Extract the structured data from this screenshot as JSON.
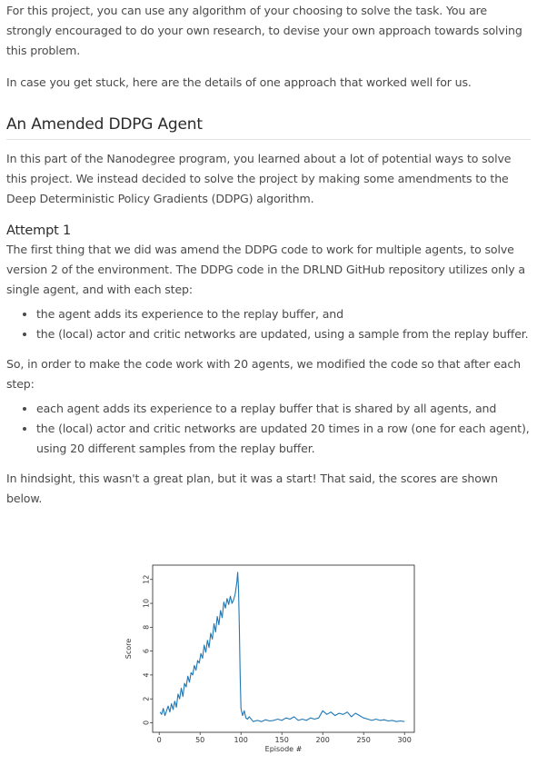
{
  "intro": {
    "p1": "For this project, you can use any algorithm of your choosing to solve the task. You are strongly encouraged to do your own research, to devise your own approach towards solving this problem.",
    "p2": "In case you get stuck, here are the details of one approach that worked well for us."
  },
  "section": {
    "heading": "An Amended DDPG Agent",
    "p1": "In this part of the Nanodegree program, you learned about a lot of potential ways to solve this project. We instead decided to solve the project by making some amendments to the Deep Deterministic Policy Gradients (DDPG) algorithm."
  },
  "attempt": {
    "heading": "Attempt 1",
    "p1": "The first thing that we did was amend the DDPG code to work for multiple agents, to solve version 2 of the environment. The DDPG code in the DRLND GitHub repository utilizes only a single agent, and with each step:",
    "list1": [
      "the agent adds its experience to the replay buffer, and",
      "the (local) actor and critic networks are updated, using a sample from the replay buffer."
    ],
    "p2": "So, in order to make the code work with 20 agents, we modified the code so that after each step:",
    "list2": [
      "each agent adds its experience to a replay buffer that is shared by all agents, and",
      "the (local) actor and critic networks are updated 20 times in a row (one for each agent), using 20 different samples from the replay buffer."
    ],
    "p3": "In hindsight, this wasn't a great plan, but it was a start! That said, the scores are shown below."
  },
  "chart_data": {
    "type": "line",
    "xlabel": "Episode #",
    "ylabel": "Score",
    "xlim": [
      -8,
      312
    ],
    "ylim": [
      -0.8,
      13.2
    ],
    "xticks": [
      0,
      50,
      100,
      150,
      200,
      250,
      300
    ],
    "yticks": [
      0,
      2,
      4,
      6,
      8,
      10,
      12
    ],
    "line_color": "#1f77b4",
    "series": [
      {
        "x": [
          1,
          3,
          5,
          7,
          9,
          11,
          13,
          15,
          17,
          19,
          21,
          23,
          25,
          27,
          29,
          31,
          33,
          35,
          37,
          39,
          41,
          43,
          45,
          47,
          49,
          51,
          53,
          55,
          57,
          59,
          61,
          63,
          65,
          67,
          69,
          71,
          73,
          75,
          77,
          79,
          81,
          83,
          85,
          87,
          89,
          91,
          93,
          95,
          96,
          97,
          98,
          99,
          100,
          102,
          104,
          106,
          108,
          110,
          115,
          120,
          125,
          130,
          135,
          140,
          145,
          150,
          155,
          160,
          165,
          170,
          175,
          180,
          185,
          190,
          195,
          200,
          205,
          210,
          215,
          220,
          225,
          230,
          235,
          240,
          245,
          250,
          255,
          260,
          265,
          270,
          275,
          280,
          285,
          290,
          295,
          300
        ],
        "y": [
          0.9,
          0.7,
          1.2,
          0.6,
          1.0,
          1.4,
          0.9,
          1.6,
          1.1,
          1.8,
          1.3,
          2.4,
          2.0,
          2.9,
          2.2,
          3.3,
          3.0,
          3.9,
          3.4,
          4.2,
          4.0,
          4.8,
          4.4,
          5.2,
          5.0,
          5.8,
          5.4,
          6.5,
          5.9,
          6.9,
          6.3,
          7.5,
          7.0,
          8.3,
          7.6,
          8.9,
          8.2,
          9.4,
          8.8,
          10.1,
          9.6,
          10.4,
          9.9,
          10.6,
          10.0,
          10.3,
          10.8,
          11.8,
          12.6,
          11.2,
          8.0,
          4.0,
          1.2,
          0.6,
          1.0,
          0.4,
          0.3,
          0.5,
          0.1,
          0.2,
          0.1,
          0.25,
          0.15,
          0.2,
          0.3,
          0.2,
          0.4,
          0.3,
          0.5,
          0.2,
          0.3,
          0.2,
          0.4,
          0.3,
          0.4,
          1.0,
          0.7,
          0.9,
          0.6,
          0.8,
          0.7,
          0.9,
          0.5,
          0.8,
          0.6,
          0.4,
          0.3,
          0.2,
          0.3,
          0.2,
          0.25,
          0.15,
          0.2,
          0.1,
          0.15,
          0.1
        ]
      }
    ]
  }
}
